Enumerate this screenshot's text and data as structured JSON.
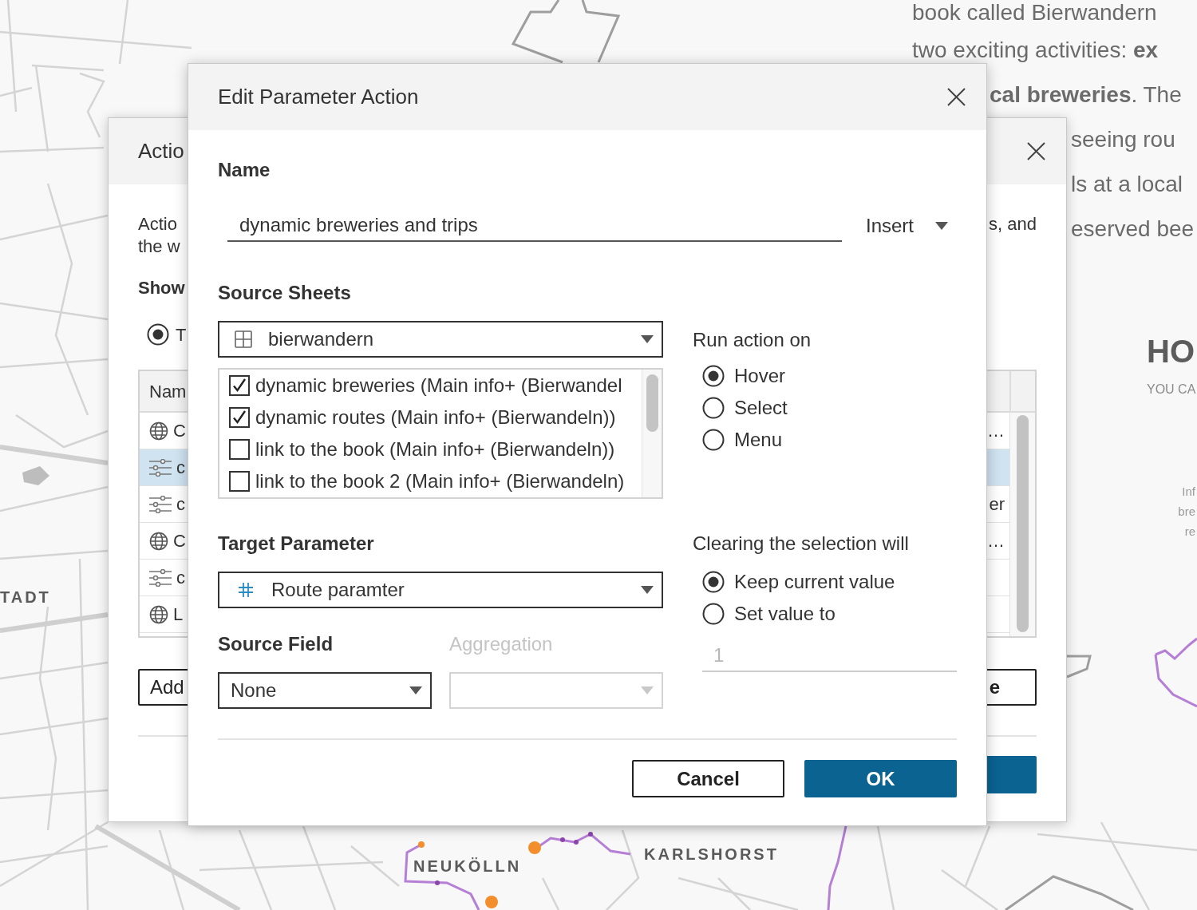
{
  "background_page": {
    "article_lines": [
      "book called Bierwandern",
      "two exciting activities: **ex**",
      "**cal breweries**. The",
      "seeing rou",
      "ls at a local",
      "eserved bee"
    ],
    "side_heading": "HO",
    "side_subheading": "YOU CA",
    "side_note_lines": [
      "Inf",
      "bre",
      "re"
    ],
    "map_labels": [
      "TADT",
      "NEUKÖLLN",
      "KARLSHORST"
    ]
  },
  "actions_dialog": {
    "title": "Actio",
    "description_lines": [
      "Actio",
      "the w"
    ],
    "description_end": "s, and",
    "show_label": "Show",
    "show_option": {
      "label": "T",
      "selected": true
    },
    "table": {
      "header": "Nam",
      "rows": [
        {
          "kind": "url",
          "column_1": "C",
          "column_2": "…",
          "selected": false
        },
        {
          "kind": "parameter",
          "column_1": "c",
          "selected": true
        },
        {
          "kind": "parameter",
          "column_1": "c",
          "column_2": "er",
          "selected": false
        },
        {
          "kind": "url",
          "column_1": "C",
          "column_2": "…",
          "selected": false
        },
        {
          "kind": "parameter",
          "column_1": "c",
          "selected": false
        },
        {
          "kind": "url",
          "column_1": "L",
          "selected": false
        }
      ]
    },
    "buttons": [
      {
        "label": "Add"
      },
      {
        "label": "e"
      }
    ]
  },
  "edit_dialog": {
    "title": "Edit Parameter Action",
    "name": {
      "label": "Name",
      "value": "dynamic breweries and trips",
      "insert_menu": "Insert"
    },
    "source_sheets": {
      "label": "Source Sheets",
      "workbook": "bierwandern",
      "sheets": [
        {
          "label": "dynamic breweries (Main info+ (Bierwandel",
          "checked": true
        },
        {
          "label": "dynamic routes (Main info+ (Bierwandeln))",
          "checked": true
        },
        {
          "label": "link to the book (Main info+ (Bierwandeln))",
          "checked": false
        },
        {
          "label": "link to the book 2 (Main info+ (Bierwandeln)",
          "checked": false
        }
      ]
    },
    "run_action_on": {
      "label": "Run action on",
      "options": [
        {
          "label": "Hover",
          "selected": true
        },
        {
          "label": "Select",
          "selected": false
        },
        {
          "label": "Menu",
          "selected": false
        }
      ]
    },
    "target_parameter": {
      "label": "Target Parameter",
      "value": "Route paramter"
    },
    "source_field": {
      "label": "Source Field",
      "value": "None"
    },
    "aggregation": {
      "label": "Aggregation",
      "disabled": true
    },
    "clearing": {
      "label": "Clearing the selection will",
      "options": [
        {
          "label": "Keep current value",
          "selected": true
        },
        {
          "label": "Set value to",
          "selected": false
        }
      ],
      "set_value": {
        "value": "1",
        "disabled": true
      }
    },
    "buttons": [
      {
        "label": "Cancel",
        "kind": "secondary"
      },
      {
        "label": "OK",
        "kind": "primary"
      }
    ]
  }
}
